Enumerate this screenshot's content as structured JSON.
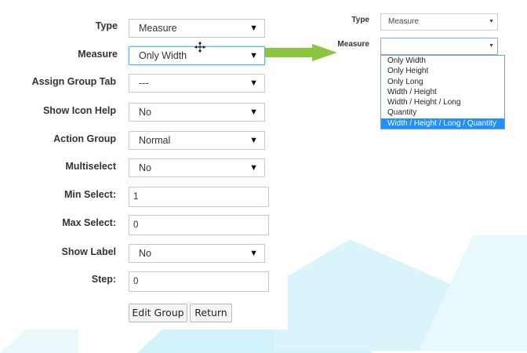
{
  "form": {
    "type_label": "Type",
    "type_value": "Measure",
    "measure_label": "Measure",
    "measure_value": "Only Width",
    "assign_group_tab_label": "Assign Group Tab",
    "assign_group_tab_value": "---",
    "show_icon_help_label": "Show Icon Help",
    "show_icon_help_value": "No",
    "action_group_label": "Action Group",
    "action_group_value": "Normal",
    "multiselect_label": "Multiselect",
    "multiselect_value": "No",
    "min_select_label": "Min Select:",
    "min_select_value": "1",
    "max_select_label": "Max Select:",
    "max_select_value": "0",
    "show_label_label": "Show Label",
    "show_label_value": "No",
    "step_label": "Step:",
    "step_value": "0",
    "edit_group_button": "Edit Group",
    "return_button": "Return"
  },
  "mini": {
    "type_label": "Type",
    "type_value": "Measure",
    "measure_label": "Measure",
    "measure_value": "",
    "options": [
      "Only Width",
      "Only Height",
      "Only Long",
      "Width / Height",
      "Width / Height / Long",
      "Quantity",
      "Width / Height / Long / Quantity"
    ],
    "highlighted_option": "Width / Height / Long / Quantity"
  },
  "colors": {
    "arrow": "#8cc63f",
    "highlight": "#1e90ff",
    "background_shapes": "#d2f3fb"
  },
  "icons": {
    "caret": "▼",
    "cursor": "crosshair-move-cursor"
  }
}
